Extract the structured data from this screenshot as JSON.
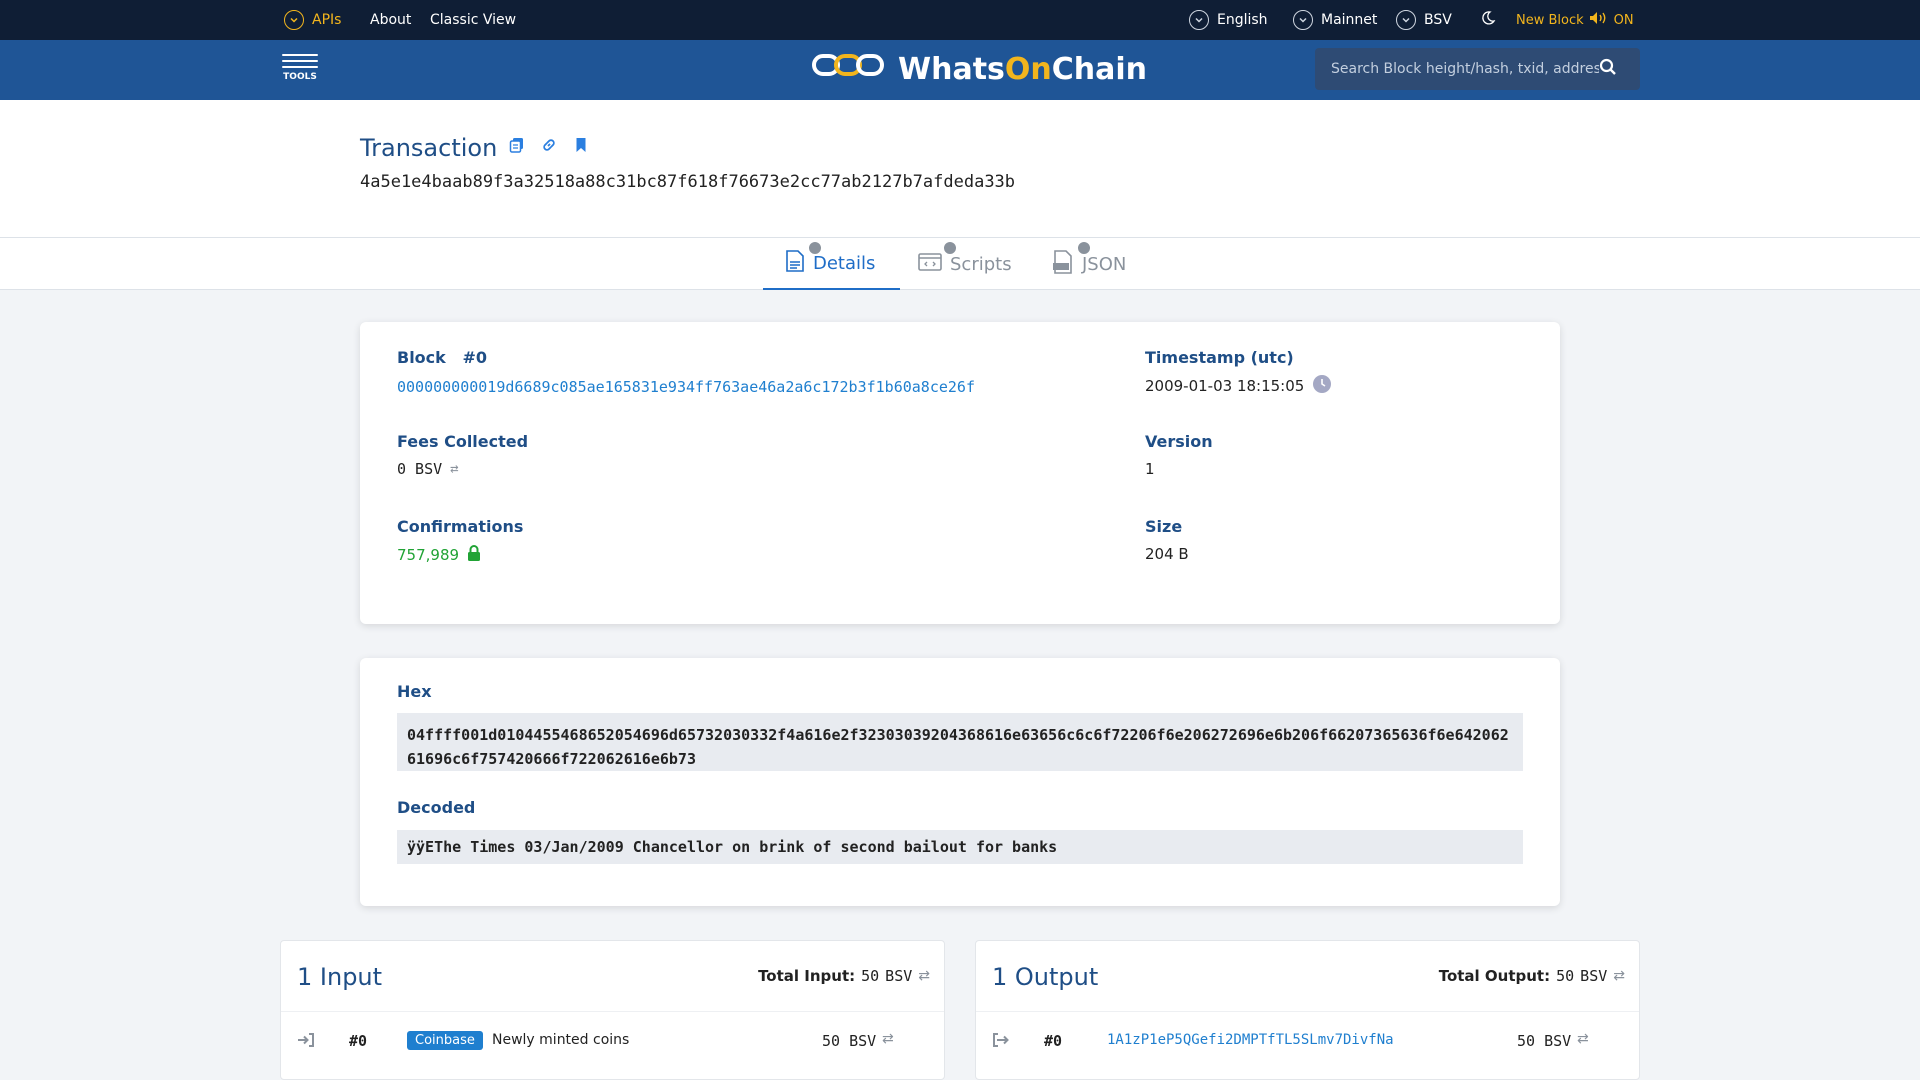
{
  "topbar": {
    "apis": "APIs",
    "about": "About",
    "classic": "Classic View",
    "language": "English",
    "network": "Mainnet",
    "coin": "BSV",
    "new_block_label": "New Block",
    "new_block_state": "ON"
  },
  "header": {
    "tools": "TOOLS",
    "brand_a": "Whats",
    "brand_b": "On",
    "brand_c": "Chain",
    "search_placeholder": "Search Block height/hash, txid, address"
  },
  "transaction": {
    "title": "Transaction",
    "txid": "4a5e1e4baab89f3a32518a88c31bc87f618f76673e2cc77ab2127b7afdeda33b"
  },
  "tabs": [
    {
      "label": "Details"
    },
    {
      "label": "Scripts"
    },
    {
      "label": "JSON"
    }
  ],
  "details": {
    "block_label": "Block",
    "block_num": "#0",
    "block_hash": "000000000019d6689c085ae165831e934ff763ae46a2a6c172b3f1b60a8ce26f",
    "timestamp_label": "Timestamp (utc)",
    "timestamp": "2009-01-03 18:15:05",
    "fees_label": "Fees Collected",
    "fees": "0 BSV",
    "version_label": "Version",
    "version": "1",
    "confirmations_label": "Confirmations",
    "confirmations": "757,989",
    "size_label": "Size",
    "size": "204 B"
  },
  "script": {
    "hex_label": "Hex",
    "hex": "04ffff001d0104455468652054696d65732030332f4a616e2f32303039204368616e63656c6c6f72206f6e206272696e6b206f66207365636f6e64206261696c6f757420666f722062616e6b73",
    "decoded_label": "Decoded",
    "decoded": "ÿÿEThe Times 03/Jan/2009 Chancellor on brink of second bailout for banks"
  },
  "inputs": {
    "title": "1 Input",
    "total_label": "Total Input:",
    "total_value": "50",
    "total_unit": "BSV",
    "rows": [
      {
        "index": "#0",
        "tag": "Coinbase",
        "text": "Newly minted coins",
        "amount": "50",
        "unit": "BSV"
      }
    ]
  },
  "outputs": {
    "title": "1 Output",
    "total_label": "Total Output:",
    "total_value": "50",
    "total_unit": "BSV",
    "rows": [
      {
        "index": "#0",
        "address": "1A1zP1eP5QGefi2DMPTfTL5SLmv7DivfNa",
        "amount": "50",
        "unit": "BSV"
      }
    ]
  },
  "colors": {
    "navy": "#0f1e35",
    "header_blue": "#1f5596",
    "gold": "#f2b51d",
    "link_blue": "#1f7fcf",
    "green": "#21a335"
  }
}
